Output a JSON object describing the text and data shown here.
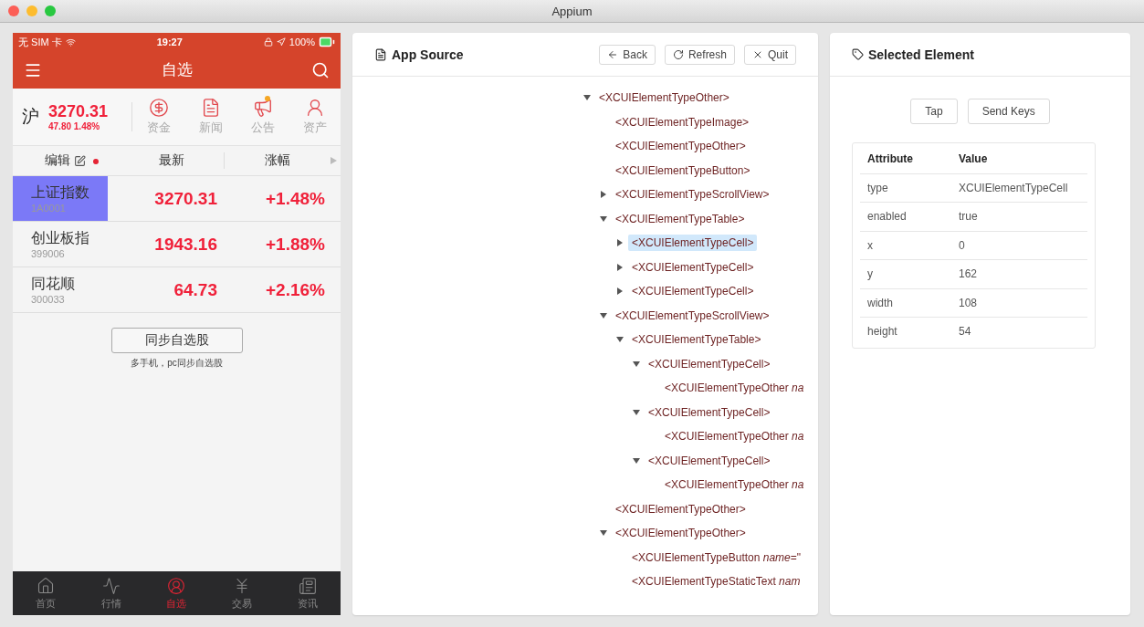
{
  "window": {
    "title": "Appium"
  },
  "phone": {
    "status_bar": {
      "carrier": "无 SIM 卡",
      "time": "19:27",
      "battery": "100%"
    },
    "nav": {
      "title": "自选"
    },
    "index": {
      "market": "沪",
      "value": "3270.31",
      "change": "47.80 1.48%"
    },
    "shortcuts": [
      {
        "label": "资金",
        "kind": "dollar",
        "badge": false
      },
      {
        "label": "新闻",
        "kind": "news",
        "badge": false
      },
      {
        "label": "公告",
        "kind": "speaker",
        "badge": true
      },
      {
        "label": "资产",
        "kind": "user",
        "badge": false
      }
    ],
    "columns": [
      {
        "label": "编辑",
        "kind": "edit"
      },
      {
        "label": "最新",
        "kind": "plain"
      },
      {
        "label": "涨幅",
        "kind": "plain"
      }
    ],
    "stocks": [
      {
        "name": "上证指数",
        "code": "1A0001",
        "price": "3270.31",
        "change": "+1.48%",
        "selected": true
      },
      {
        "name": "创业板指",
        "code": "399006",
        "price": "1943.16",
        "change": "+1.88%",
        "selected": false
      },
      {
        "name": "同花顺",
        "code": "300033",
        "price": "64.73",
        "change": "+2.16%",
        "selected": false
      }
    ],
    "sync_button": "同步自选股",
    "sync_caption": "多手机，pc同步自选股",
    "tabbar": [
      {
        "label": "首页",
        "kind": "home",
        "selected": false
      },
      {
        "label": "行情",
        "kind": "chart",
        "selected": false
      },
      {
        "label": "自选",
        "kind": "user",
        "selected": true
      },
      {
        "label": "交易",
        "kind": "yen",
        "selected": false
      },
      {
        "label": "资讯",
        "kind": "news",
        "selected": false
      }
    ]
  },
  "source": {
    "title": "App Source",
    "buttons": [
      {
        "label": "Back",
        "kind": "back"
      },
      {
        "label": "Refresh",
        "kind": "refresh"
      },
      {
        "label": "Quit",
        "kind": "quit"
      }
    ],
    "tree": [
      {
        "label": "<XCUIElementTypeOther>",
        "kind": "branch",
        "expanded": true,
        "selected": false,
        "children": [
          {
            "label": "<XCUIElementTypeImage>",
            "kind": "leaf",
            "selected": false
          },
          {
            "label": "<XCUIElementTypeOther>",
            "kind": "leaf",
            "selected": false
          },
          {
            "label": "<XCUIElementTypeButton>",
            "kind": "leaf",
            "selected": false
          },
          {
            "label": "<XCUIElementTypeScrollView>",
            "kind": "branch",
            "expanded": false,
            "selected": false
          },
          {
            "label": "<XCUIElementTypeTable>",
            "kind": "branch",
            "expanded": true,
            "selected": false,
            "children": [
              {
                "label": "<XCUIElementTypeCell>",
                "kind": "branch",
                "expanded": false,
                "selected": true
              },
              {
                "label": "<XCUIElementTypeCell>",
                "kind": "branch",
                "expanded": false,
                "selected": false
              },
              {
                "label": "<XCUIElementTypeCell>",
                "kind": "branch",
                "expanded": false,
                "selected": false
              }
            ]
          },
          {
            "label": "<XCUIElementTypeScrollView>",
            "kind": "branch",
            "expanded": true,
            "selected": false,
            "children": [
              {
                "label": "<XCUIElementTypeTable>",
                "kind": "branch",
                "expanded": true,
                "selected": false,
                "children": [
                  {
                    "label": "<XCUIElementTypeCell>",
                    "kind": "branch",
                    "expanded": true,
                    "selected": false,
                    "children": [
                      {
                        "label": "<XCUIElementTypeOther *na*",
                        "kind": "leaf",
                        "selected": false
                      }
                    ]
                  },
                  {
                    "label": "<XCUIElementTypeCell>",
                    "kind": "branch",
                    "expanded": true,
                    "selected": false,
                    "children": [
                      {
                        "label": "<XCUIElementTypeOther *na*",
                        "kind": "leaf",
                        "selected": false
                      }
                    ]
                  },
                  {
                    "label": "<XCUIElementTypeCell>",
                    "kind": "branch",
                    "expanded": true,
                    "selected": false,
                    "children": [
                      {
                        "label": "<XCUIElementTypeOther *na*",
                        "kind": "leaf",
                        "selected": false
                      }
                    ]
                  }
                ]
              }
            ]
          },
          {
            "label": "<XCUIElementTypeOther>",
            "kind": "leaf",
            "selected": false
          },
          {
            "label": "<XCUIElementTypeOther>",
            "kind": "branch",
            "expanded": true,
            "selected": false,
            "children": [
              {
                "label": "<XCUIElementTypeButton *name*=\"",
                "kind": "leaf",
                "selected": false
              },
              {
                "label": "<XCUIElementTypeStaticText *nam*",
                "kind": "leaf",
                "selected": false
              }
            ]
          }
        ]
      }
    ]
  },
  "element": {
    "title": "Selected Element",
    "actions": [
      "Tap",
      "Send Keys"
    ],
    "columns": [
      "Attribute",
      "Value"
    ],
    "rows": [
      {
        "attribute": "type",
        "value": "XCUIElementTypeCell"
      },
      {
        "attribute": "enabled",
        "value": "true"
      },
      {
        "attribute": "x",
        "value": "0"
      },
      {
        "attribute": "y",
        "value": "162"
      },
      {
        "attribute": "width",
        "value": "108"
      },
      {
        "attribute": "height",
        "value": "54"
      }
    ]
  }
}
